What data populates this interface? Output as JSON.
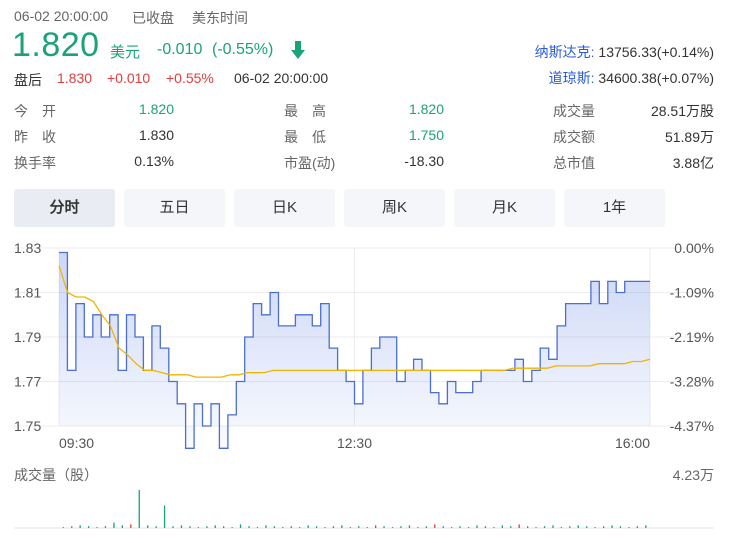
{
  "header": {
    "datetime": "06-02 20:00:00",
    "status": "已收盘",
    "timezone": "美东时间",
    "price": "1.820",
    "currency": "美元",
    "change": "-0.010",
    "change_pct": "(-0.55%)",
    "trend_icon": "down-arrow-icon"
  },
  "indices": [
    {
      "name": "纳斯达克:",
      "value": "13756.33(+0.14%)"
    },
    {
      "name": "道琼斯:",
      "value": "34600.38(+0.07%)"
    }
  ],
  "after_hours": {
    "label": "盘后",
    "price": "1.830",
    "change": "+0.010",
    "change_pct": "+0.55%",
    "datetime": "06-02 20:00:00"
  },
  "stats": {
    "open_label": "今　开",
    "open": "1.820",
    "high_label": "最　高",
    "high": "1.820",
    "volume_label": "成交量",
    "volume": "28.51万股",
    "prev_label": "昨　收",
    "prev": "1.830",
    "low_label": "最　低",
    "low": "1.750",
    "amount_label": "成交额",
    "amount": "51.89万",
    "turnover_label": "换手率",
    "turnover": "0.13%",
    "pe_label": "市盈(动)",
    "pe": "-18.30",
    "mcap_label": "总市值",
    "mcap": "3.88亿"
  },
  "tabs": [
    "分时",
    "五日",
    "日K",
    "周K",
    "月K",
    "1年"
  ],
  "colors": {
    "up": "#e23c3c",
    "down": "#1aa37a",
    "price_line": "#4a6fd0",
    "avg_line": "#f0b400"
  },
  "chart_data": {
    "type": "line",
    "ylim": [
      1.75,
      1.83
    ],
    "y_ticks": [
      "1.83",
      "1.81",
      "1.79",
      "1.77",
      "1.75"
    ],
    "y_right_ticks": [
      "0.00%",
      "-1.09%",
      "-2.19%",
      "-3.28%",
      "-4.37%"
    ],
    "x_ticks": [
      "09:30",
      "12:30",
      "16:00"
    ],
    "series": [
      {
        "values": [
          1.828,
          1.775,
          1.805,
          1.79,
          1.8,
          1.79,
          1.8,
          1.775,
          1.8,
          1.79,
          1.775,
          1.795,
          1.785,
          1.77,
          1.76,
          1.74,
          1.76,
          1.75,
          1.76,
          1.74,
          1.755,
          1.77,
          1.79,
          1.805,
          1.8,
          1.81,
          1.795,
          1.795,
          1.8,
          1.8,
          1.795,
          1.805,
          1.785,
          1.775,
          1.77,
          1.76,
          1.775,
          1.785,
          1.79,
          1.79,
          1.77,
          1.775,
          1.78,
          1.775,
          1.765,
          1.76,
          1.77,
          1.765,
          1.765,
          1.77,
          1.775,
          1.775,
          1.775,
          1.775,
          1.78,
          1.77,
          1.775,
          1.785,
          1.78,
          1.795,
          1.805,
          1.805,
          1.805,
          1.815,
          1.805,
          1.815,
          1.81,
          1.815,
          1.815,
          1.815
        ]
      },
      {
        "values": [
          1.822,
          1.81,
          1.808,
          1.808,
          1.806,
          1.8,
          1.795,
          1.785,
          1.782,
          1.778,
          1.775,
          1.775,
          1.774,
          1.773,
          1.773,
          1.773,
          1.772,
          1.772,
          1.772,
          1.772,
          1.773,
          1.773,
          1.774,
          1.774,
          1.774,
          1.775,
          1.775,
          1.775,
          1.775,
          1.775,
          1.775,
          1.775,
          1.775,
          1.775,
          1.775,
          1.775,
          1.775,
          1.775,
          1.775,
          1.775,
          1.775,
          1.775,
          1.775,
          1.775,
          1.775,
          1.775,
          1.775,
          1.775,
          1.775,
          1.775,
          1.775,
          1.775,
          1.775,
          1.776,
          1.776,
          1.776,
          1.776,
          1.776,
          1.777,
          1.777,
          1.777,
          1.777,
          1.777,
          1.778,
          1.778,
          1.778,
          1.778,
          1.779,
          1.779,
          1.78
        ]
      }
    ],
    "volume": {
      "label": "成交量（股）",
      "max_label": "4.23万",
      "max": 4.23,
      "values": [
        0.1,
        0.2,
        0.3,
        0.2,
        0.1,
        0.2,
        0.6,
        0.3,
        0.4,
        4.23,
        0.3,
        0.2,
        2.5,
        0.2,
        0.3,
        0.2,
        0.1,
        0.2,
        0.3,
        0.2,
        0.1,
        0.4,
        0.2,
        0.1,
        0.3,
        0.2,
        0.1,
        0.2,
        0.1,
        0.3,
        0.2,
        0.1,
        0.2,
        0.3,
        0.1,
        0.2,
        0.1,
        0.3,
        0.2,
        0.1,
        0.2,
        0.3,
        0.1,
        0.2,
        0.4,
        0.2,
        0.1,
        0.2,
        0.1,
        0.3,
        0.2,
        0.1,
        0.3,
        0.2,
        0.4,
        0.2,
        0.1,
        0.2,
        0.3,
        0.1,
        0.2,
        0.3,
        0.2,
        0.1,
        0.2,
        0.3,
        0.2,
        0.1,
        0.2,
        0.3
      ],
      "up": [
        0,
        0,
        0,
        0,
        0,
        0,
        0,
        0,
        1,
        0,
        0,
        0,
        0,
        0,
        0,
        0,
        0,
        0,
        0,
        0,
        0,
        0,
        0,
        0,
        0,
        0,
        0,
        0,
        0,
        0,
        0,
        0,
        0,
        0,
        0,
        0,
        0,
        1,
        0,
        0,
        0,
        0,
        0,
        0,
        1,
        0,
        0,
        0,
        0,
        0,
        0,
        0,
        0,
        0,
        1,
        0,
        0,
        0,
        0,
        0,
        0,
        0,
        0,
        0,
        0,
        0,
        0,
        0,
        0,
        0
      ]
    }
  }
}
